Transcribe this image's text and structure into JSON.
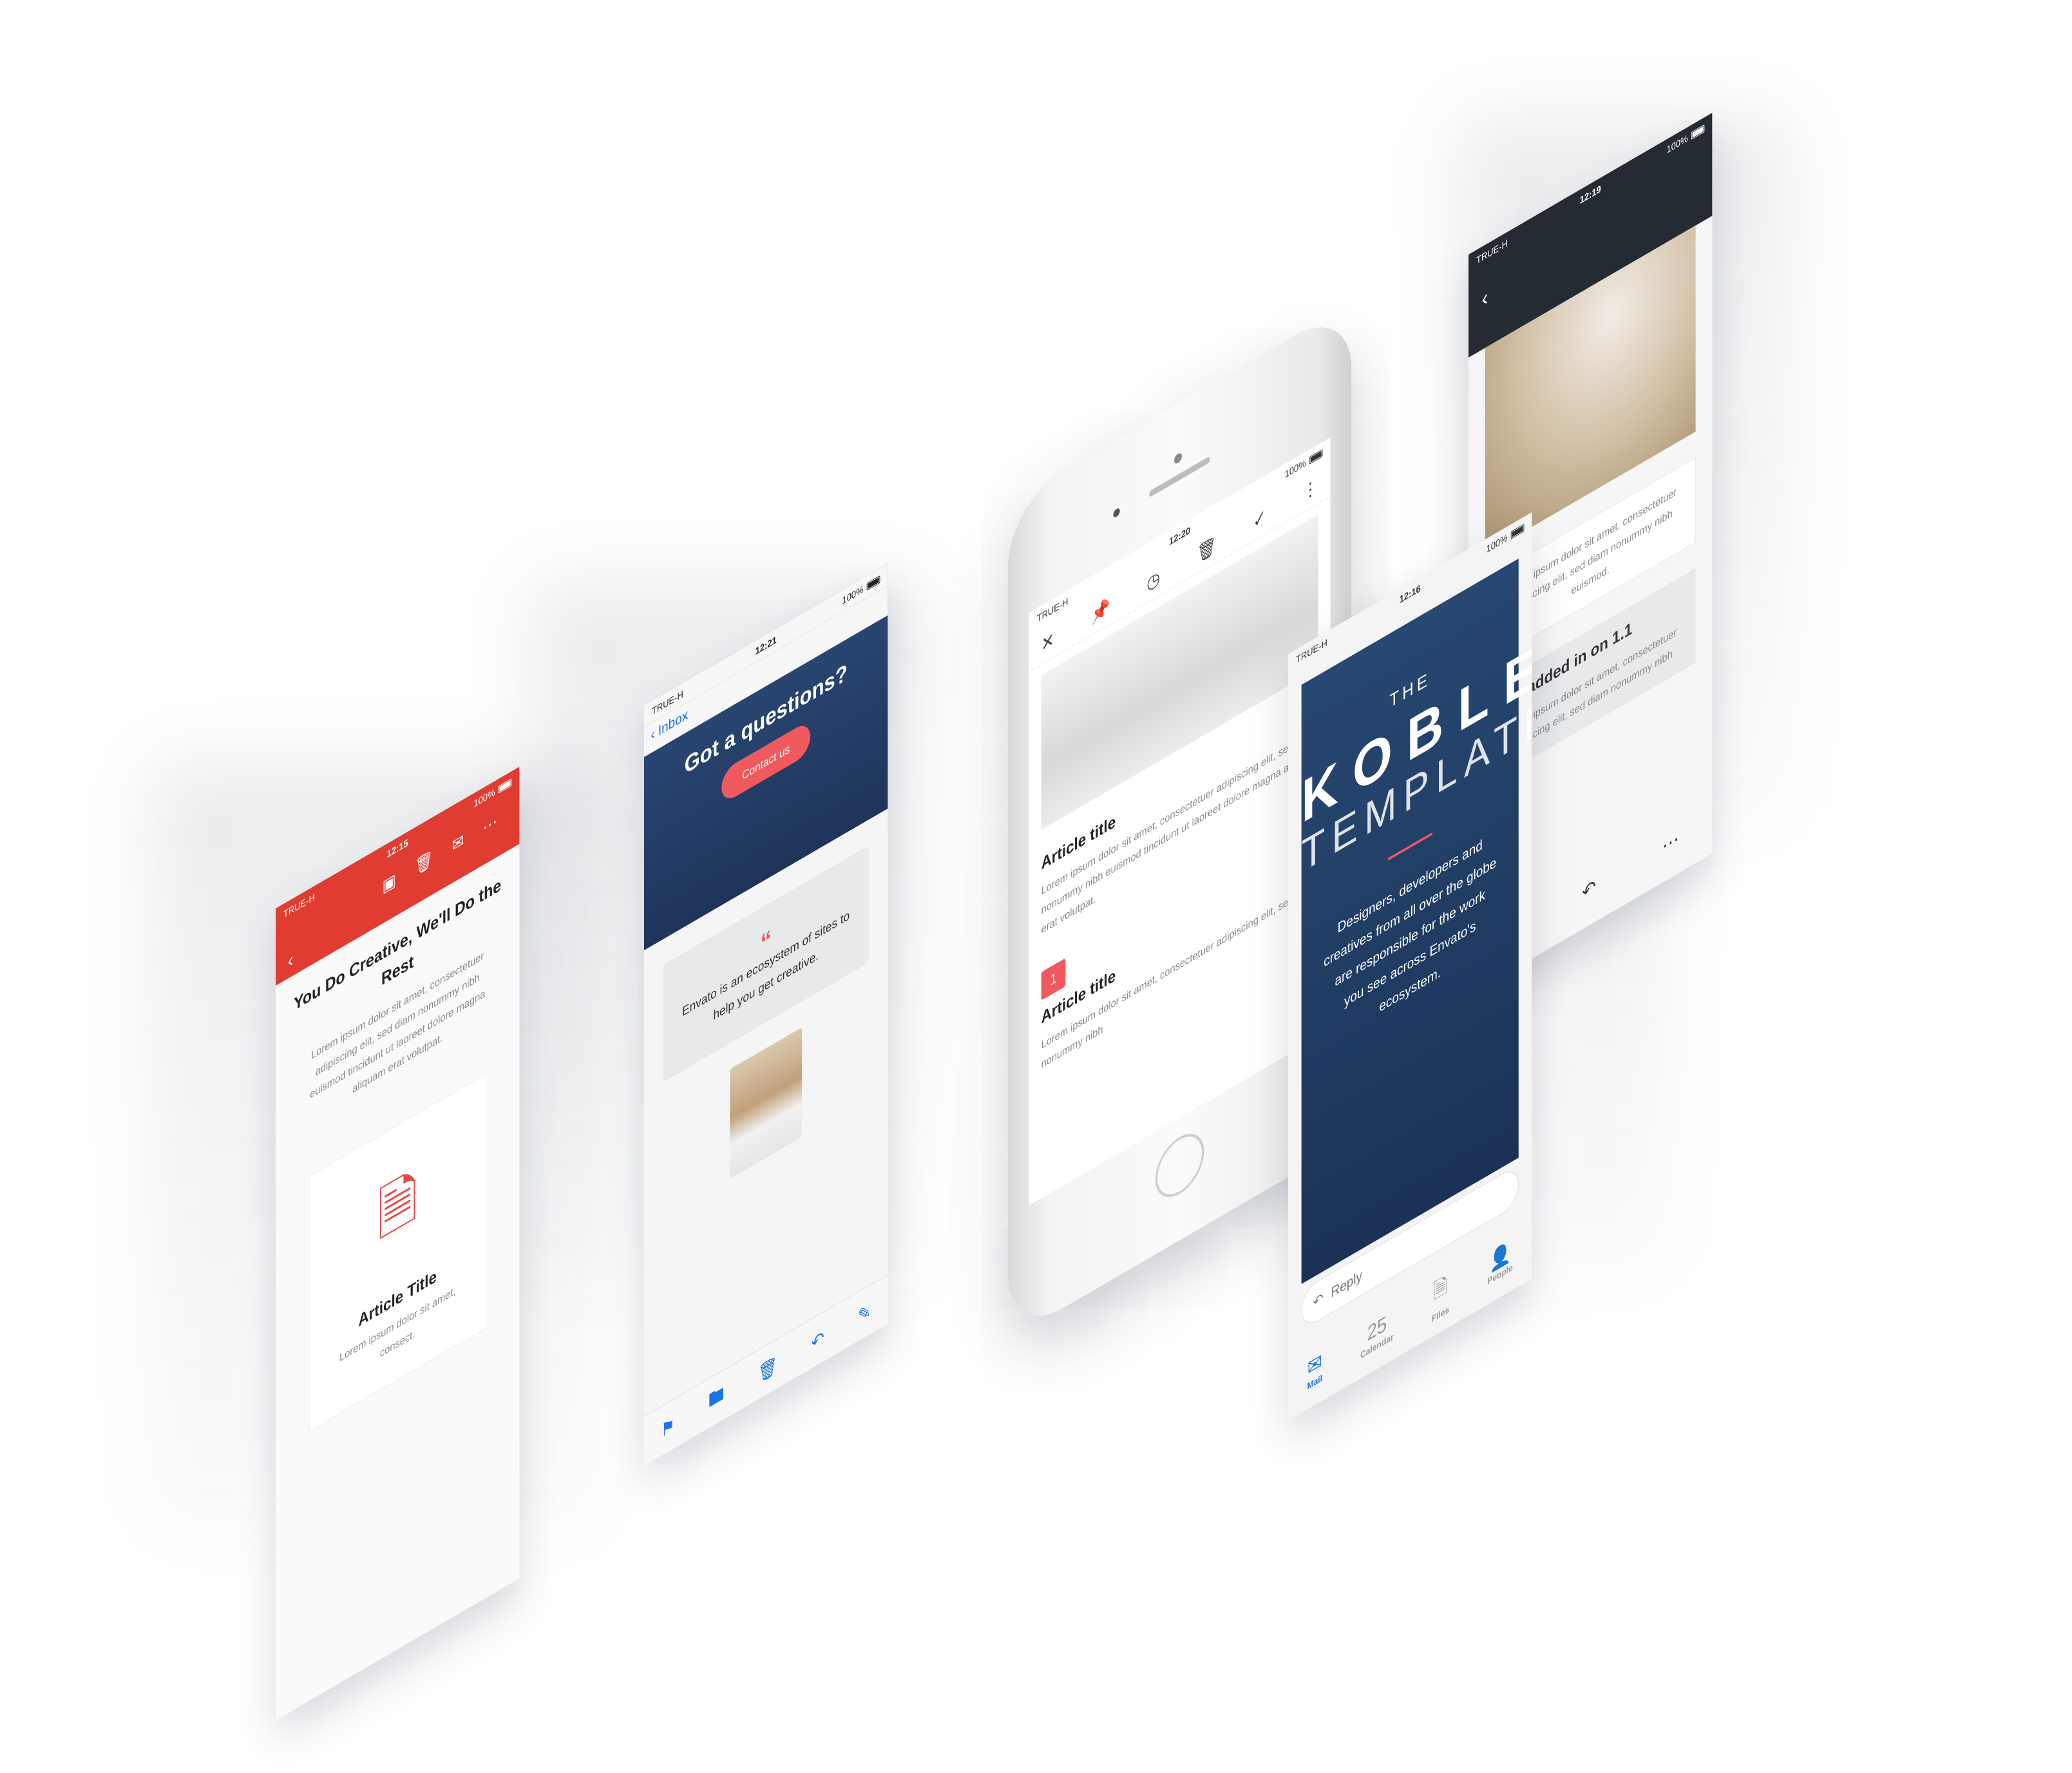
{
  "status": {
    "carrier": "TRUE-H",
    "battery": "100%"
  },
  "screen1": {
    "time": "12:15",
    "headline": "You Do Creative, We'll Do the Rest",
    "body": "Lorem ipsum dolor sit amet, consectetuer adipiscing elit, sed diam nonummy nibh euismod tincidunt ut laoreet dolore magna aliquam erat volutpat.",
    "card_title": "Article Title",
    "card_body": "Lorem ipsum dolor sit amet, consect."
  },
  "screen2": {
    "time": "12:21",
    "back_label": "Inbox",
    "hero_title": "Got a questions?",
    "contact_button": "Contact us",
    "quote": "Envato is an ecosystem of sites to help you get creative."
  },
  "phone": {
    "time": "12:20",
    "article1_title": "Article title",
    "article1_body": "Lorem ipsum dolor sit amet, consectetuer adipiscing elit, sed diam nonummy nibh euismod tincidunt ut laoreet dolore magna aliquam erat volutpat.",
    "number": "1",
    "article2_title": "Article title",
    "article2_body": "Lorem ipsum dolor sit amet, consectetuer adipiscing elit, sed diam nonummy nibh"
  },
  "screen5": {
    "time": "12:16",
    "the": "THE",
    "brand": "KOBLE",
    "template": "TEMPLATE",
    "description": "Designers, developers and creatives from all over the globe are responsible for the work you see across Envato's ecosystem.",
    "reply_label": "Reply",
    "tabs": [
      {
        "label": "Mail",
        "icon": "mail-icon"
      },
      {
        "label": "Calendar",
        "icon": "calendar-icon",
        "date": "25"
      },
      {
        "label": "Files",
        "icon": "files-icon"
      },
      {
        "label": "People",
        "icon": "people-icon"
      }
    ]
  },
  "screen6": {
    "time": "12:19",
    "body": "Lorem ipsum dolor sit amet, consectetuer adipiscing elit, sed diam nonummy nibh euismod.",
    "box_title": "was added in on 1.1",
    "box_body": "Lorem ipsum dolor sit amet, consectetuer adipiscing elit, sed diam nonummy nibh"
  }
}
